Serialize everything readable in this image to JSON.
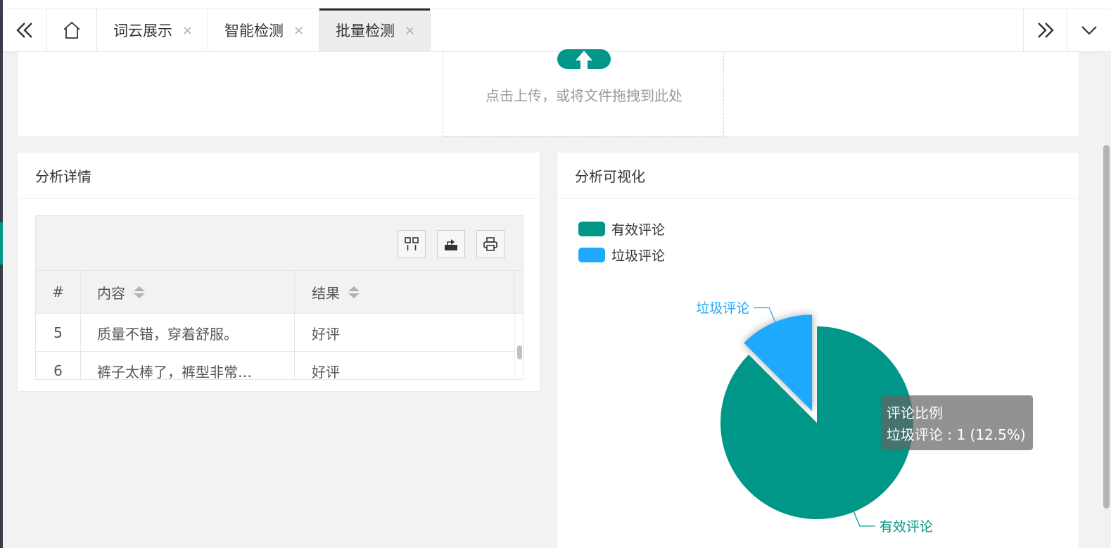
{
  "tabs": {
    "items": [
      {
        "label": "词云展示",
        "active": false
      },
      {
        "label": "智能检测",
        "active": false
      },
      {
        "label": "批量检测",
        "active": true
      }
    ],
    "close_glyph": "×"
  },
  "upload": {
    "text": "点击上传，或将文件拖拽到此处",
    "icon": "upload-cloud-icon"
  },
  "detail": {
    "title": "分析详情",
    "tools": [
      "columns-icon",
      "export-icon",
      "print-icon"
    ],
    "columns": [
      "#",
      "内容",
      "结果"
    ],
    "rows": [
      {
        "index": "5",
        "content": "质量不错，穿着舒服。",
        "result": "好评"
      },
      {
        "index": "6",
        "content": "裤子太棒了，裤型非常…",
        "result": "好评"
      }
    ]
  },
  "viz": {
    "title": "分析可视化",
    "legend": [
      {
        "label": "有效评论",
        "color": "#009688"
      },
      {
        "label": "垃圾评论",
        "color": "#1ea9ff"
      }
    ],
    "tooltip": {
      "title": "评论比例",
      "line": "垃圾评论 : 1 (12.5%)"
    }
  },
  "chart_data": {
    "type": "pie",
    "title": "评论比例",
    "categories": [
      "垃圾评论",
      "有效评论"
    ],
    "values": [
      1,
      7
    ],
    "colors": [
      "#1ea9ff",
      "#009688"
    ],
    "highlighted": "垃圾评论",
    "legend": "top-left"
  }
}
